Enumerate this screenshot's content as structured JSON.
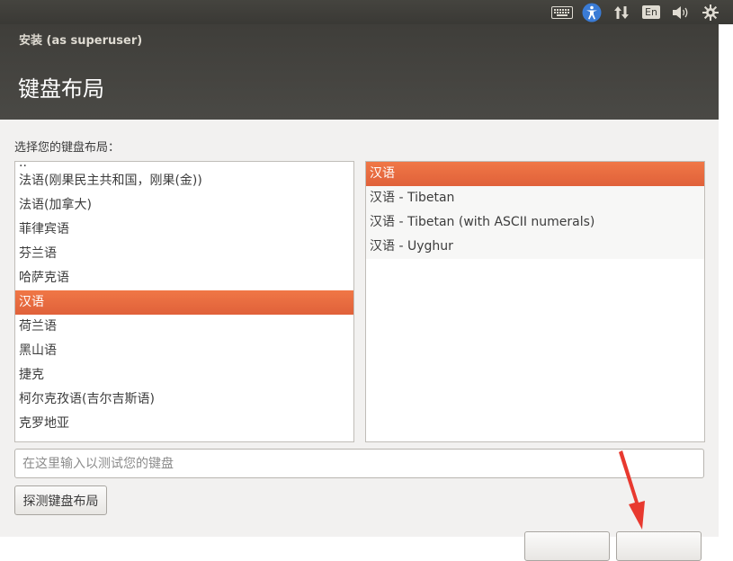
{
  "tray": {
    "icons": [
      "keyboard-icon",
      "accessibility-icon",
      "network-icon",
      "language-indicator",
      "volume-icon",
      "settings-gear-icon"
    ],
    "language_label": "En"
  },
  "window": {
    "title": "安装 (as superuser)",
    "page_title": "键盘布局"
  },
  "prompt": "选择您的键盘布局：",
  "layout_list": {
    "partial_top": "..",
    "items": [
      {
        "label": "法语(刚果民主共和国，刚果(金))",
        "selected": false
      },
      {
        "label": "法语(加拿大)",
        "selected": false
      },
      {
        "label": "菲律宾语",
        "selected": false
      },
      {
        "label": "芬兰语",
        "selected": false
      },
      {
        "label": "哈萨克语",
        "selected": false
      },
      {
        "label": "汉语",
        "selected": true
      },
      {
        "label": "荷兰语",
        "selected": false
      },
      {
        "label": "黑山语",
        "selected": false
      },
      {
        "label": "捷克",
        "selected": false
      },
      {
        "label": "柯尔克孜语(吉尔吉斯语)",
        "selected": false
      },
      {
        "label": "克罗地亚",
        "selected": false
      }
    ]
  },
  "variant_list": {
    "items": [
      {
        "label": "汉语",
        "selected": true
      },
      {
        "label": "汉语 - Tibetan",
        "selected": false
      },
      {
        "label": "汉语 - Tibetan (with ASCII numerals)",
        "selected": false
      },
      {
        "label": "汉语 - Uyghur",
        "selected": false
      }
    ]
  },
  "test_input": {
    "placeholder": "在这里输入以测试您的键盘",
    "value": ""
  },
  "buttons": {
    "detect_label": "探测键盘布局",
    "back_label": "",
    "continue_label": ""
  },
  "colors": {
    "accent": "#e9683e",
    "header": "#44433f",
    "annotation_arrow": "#e8392f"
  }
}
